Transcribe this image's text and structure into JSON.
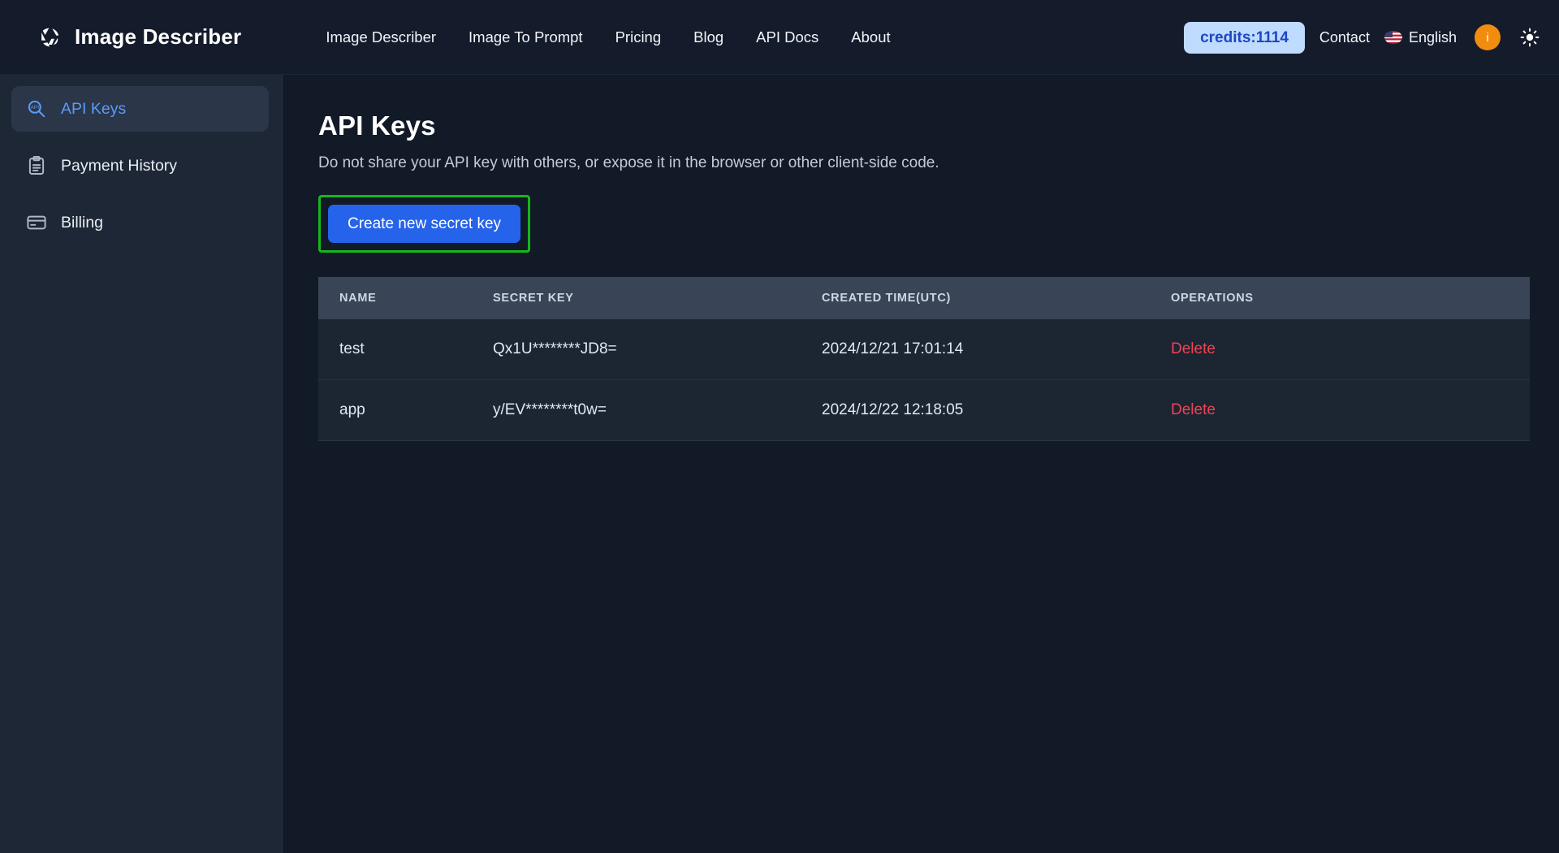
{
  "header": {
    "brand_name": "Image Describer",
    "brand_logo_icon": "aperture-icon",
    "nav": [
      {
        "label": "Image Describer"
      },
      {
        "label": "Image To Prompt"
      },
      {
        "label": "Pricing"
      },
      {
        "label": "Blog"
      },
      {
        "label": "API Docs"
      },
      {
        "label": "About"
      }
    ],
    "credits_label": "credits:1114",
    "contact_label": "Contact",
    "language_label": "English",
    "language_flag_icon": "us-flag-icon",
    "avatar_initial": "i",
    "theme_toggle_icon": "sun-icon"
  },
  "sidebar": {
    "items": [
      {
        "label": "API Keys",
        "icon": "api-search-icon",
        "active": true
      },
      {
        "label": "Payment History",
        "icon": "clipboard-icon",
        "active": false
      },
      {
        "label": "Billing",
        "icon": "credit-card-icon",
        "active": false
      }
    ]
  },
  "main": {
    "title": "API Keys",
    "description": "Do not share your API key with others, or expose it in the browser or other client-side code.",
    "create_button_label": "Create new secret key",
    "highlight_color": "#16b71a",
    "button_color": "#2563eb",
    "table": {
      "columns": [
        "NAME",
        "SECRET KEY",
        "CREATED TIME(UTC)",
        "OPERATIONS"
      ],
      "rows": [
        {
          "name": "test",
          "secret_key": "Qx1U********JD8=",
          "created_time": "2024/12/21 17:01:14",
          "operation_label": "Delete"
        },
        {
          "name": "app",
          "secret_key": "y/EV********t0w=",
          "created_time": "2024/12/22 12:18:05",
          "operation_label": "Delete"
        }
      ]
    }
  }
}
